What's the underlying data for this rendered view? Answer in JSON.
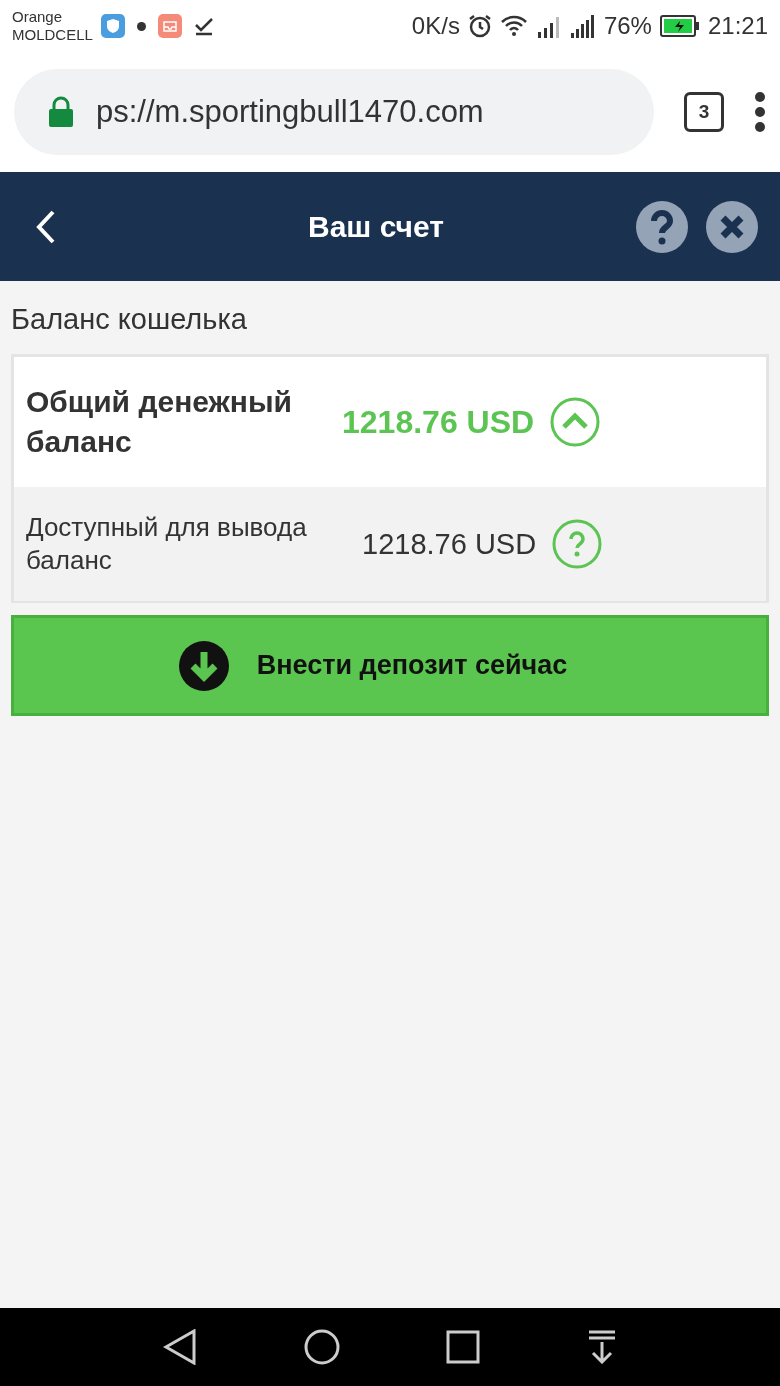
{
  "status_bar": {
    "carrier_line_1": "Orange",
    "carrier_line_2": "MOLDCELL",
    "speed": "0K/s",
    "battery": "76%",
    "time": "21:21"
  },
  "browser": {
    "url": "ps://m.sportingbull1470.com",
    "tab_count": "3"
  },
  "header": {
    "title": "Ваш счет"
  },
  "section_title": "Баланс кошелька",
  "balances": [
    {
      "kind": "total",
      "label": "Общий денежный баланс",
      "amount": "1218.76 USD",
      "expanded": true
    },
    {
      "kind": "withdrawable",
      "label": "Доступный для вывода баланс",
      "amount": "1218.76 USD"
    }
  ],
  "deposit_button": "Внести депозит сейчас"
}
